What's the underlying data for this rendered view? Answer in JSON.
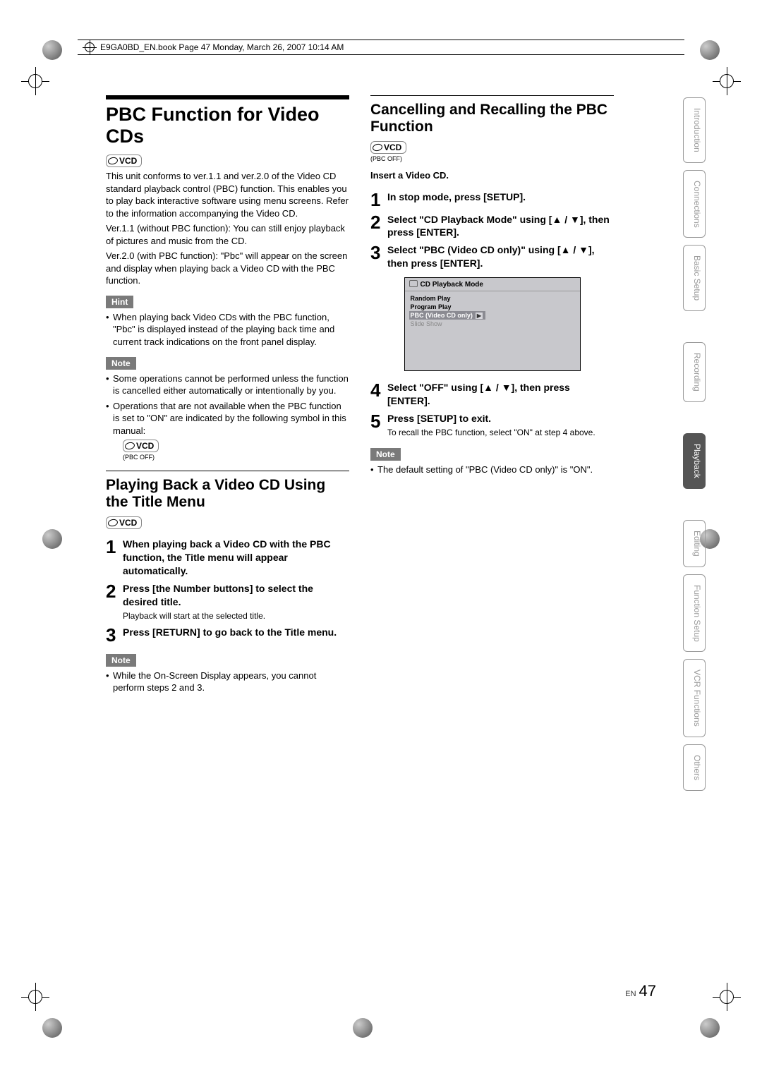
{
  "book_header": "E9GA0BD_EN.book  Page 47  Monday, March 26, 2007  10:14 AM",
  "left": {
    "title": "PBC Function for Video CDs",
    "disc": "VCD",
    "intro1": "This unit conforms to ver.1.1 and ver.2.0 of the Video CD standard playback control (PBC) function. This enables you to play back interactive software using menu screens. Refer to the information accompanying the Video CD.",
    "intro2": "Ver.1.1 (without PBC function): You can still enjoy playback of pictures and music from the CD.",
    "intro3": "Ver.2.0 (with PBC function): \"Pbc\" will appear on the screen and display when playing back a Video CD with the PBC function.",
    "hint_label": "Hint",
    "hint1": "When playing back Video CDs with the PBC function, \"Pbc\" is displayed instead of the playing back time and current track indications on the front panel display.",
    "note_label": "Note",
    "note1": "Some operations cannot be performed unless the function is cancelled either automatically or intentionally by you.",
    "note2": "Operations that are not available when the PBC function is set to \"ON\" are indicated by the following symbol in this manual:",
    "disc_off": "VCD",
    "disc_off_cap": "(PBC OFF)",
    "sub_title": "Playing Back a Video CD Using the Title Menu",
    "step1": "When playing back a Video CD with the PBC function, the Title menu will appear automatically.",
    "step2": "Press [the Number buttons] to select the desired title.",
    "step2_sub": "Playback will start at the selected title.",
    "step3": "Press [RETURN] to go back to the Title menu.",
    "note3": "While the On-Screen Display appears, you cannot perform steps 2 and 3."
  },
  "right": {
    "title": "Cancelling and Recalling the PBC Function",
    "disc": "VCD",
    "disc_cap": "(PBC OFF)",
    "insert": "Insert a Video CD.",
    "step1": "In stop mode, press [SETUP].",
    "step2": "Select \"CD Playback Mode\" using [▲ / ▼], then press [ENTER].",
    "step3": "Select \"PBC (Video CD only)\" using [▲ / ▼], then press [ENTER].",
    "menu": {
      "title": "CD Playback Mode",
      "items": [
        "Random Play",
        "Program Play",
        "PBC (Video CD only)",
        "Slide Show"
      ]
    },
    "step4": "Select \"OFF\" using [▲ / ▼], then press [ENTER].",
    "step5": "Press [SETUP] to exit.",
    "step5_sub": "To recall the PBC function, select \"ON\" at step 4 above.",
    "note_label": "Note",
    "note1": "The default setting of \"PBC (Video CD only)\" is \"ON\"."
  },
  "tabs": [
    "Introduction",
    "Connections",
    "Basic Setup",
    "Recording",
    "Playback",
    "Editing",
    "Function Setup",
    "VCR Functions",
    "Others"
  ],
  "page_lang": "EN",
  "page_num": "47"
}
